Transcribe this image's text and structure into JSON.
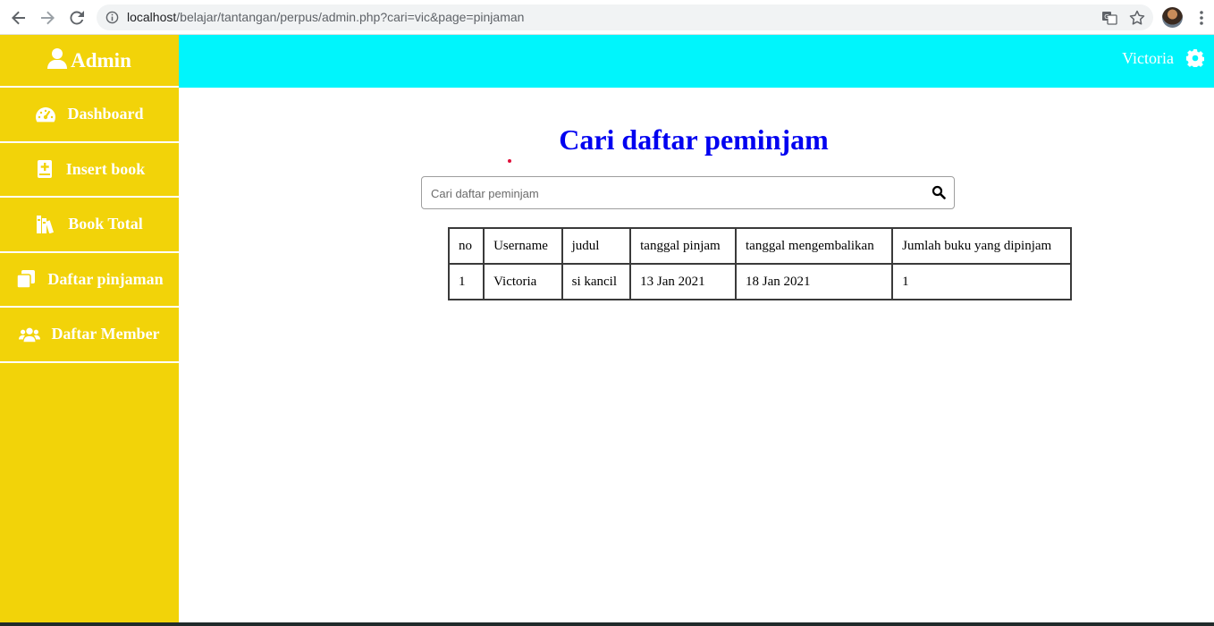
{
  "browser": {
    "url_host": "localhost",
    "url_path": "/belajar/tantangan/perpus/admin.php?cari=vic&page=pinjaman"
  },
  "sidebar": {
    "title": "Admin",
    "items": [
      {
        "label": "Dashboard",
        "icon": "tachometer-icon"
      },
      {
        "label": "Insert book",
        "icon": "book-plus-icon"
      },
      {
        "label": "Book Total",
        "icon": "book-stack-icon"
      },
      {
        "label": "Daftar pinjaman",
        "icon": "copy-icon"
      },
      {
        "label": "Daftar Member",
        "icon": "users-icon"
      }
    ]
  },
  "header": {
    "user_name": "Victoria"
  },
  "main": {
    "title": "Cari daftar peminjam",
    "search": {
      "placeholder": "Cari daftar peminjam",
      "value": ""
    },
    "table": {
      "columns": [
        "no",
        "Username",
        "judul",
        "tanggal pinjam",
        "tanggal mengembalikan",
        "Jumlah buku yang dipinjam"
      ],
      "rows": [
        [
          "1",
          "Victoria",
          "si kancil",
          "13 Jan 2021",
          "18 Jan 2021",
          "1"
        ]
      ]
    }
  },
  "colors": {
    "sidebar": "#f2d309",
    "topbar": "#00f5fc",
    "title": "#0000f0"
  }
}
